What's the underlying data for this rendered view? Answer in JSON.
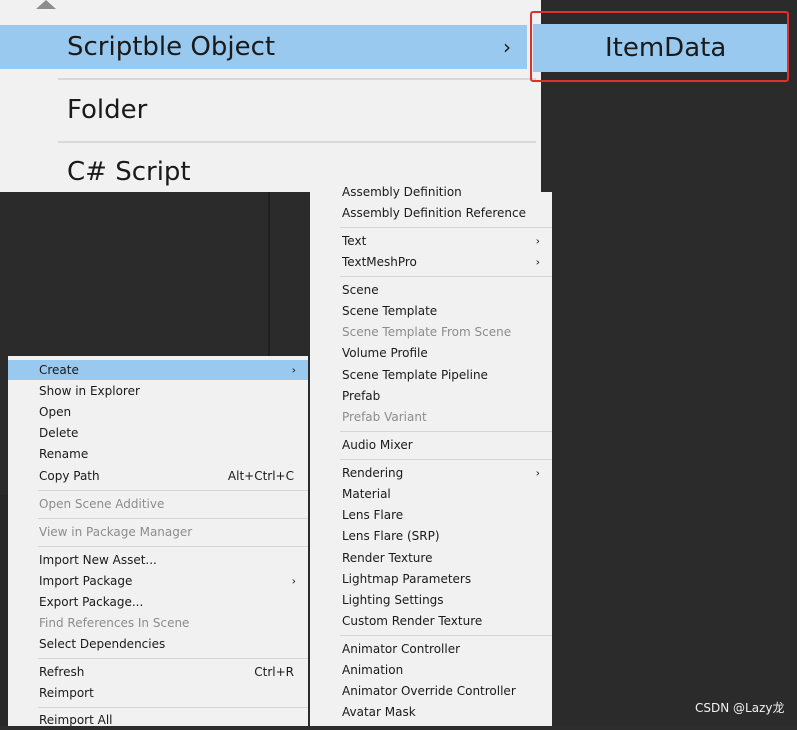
{
  "zoomed_menu": {
    "items": [
      {
        "label": "Scriptble Object",
        "highlighted": true,
        "submenu": true
      },
      {
        "label": "Folder"
      },
      {
        "label": "C# Script"
      }
    ],
    "submenu_item": "ItemData"
  },
  "context_menu": {
    "items": [
      {
        "label": "Create",
        "highlighted": true,
        "submenu": true
      },
      {
        "label": "Show in Explorer"
      },
      {
        "label": "Open"
      },
      {
        "label": "Delete"
      },
      {
        "label": "Rename"
      },
      {
        "label": "Copy Path",
        "shortcut": "Alt+Ctrl+C"
      },
      {
        "label": "Open Scene Additive",
        "disabled": true
      },
      {
        "label": "View in Package Manager",
        "disabled": true
      },
      {
        "label": "Import New Asset..."
      },
      {
        "label": "Import Package",
        "submenu": true
      },
      {
        "label": "Export Package..."
      },
      {
        "label": "Find References In Scene",
        "disabled": true
      },
      {
        "label": "Select Dependencies"
      },
      {
        "label": "Refresh",
        "shortcut": "Ctrl+R"
      },
      {
        "label": "Reimport"
      },
      {
        "label": "Reimport All"
      }
    ]
  },
  "create_submenu": {
    "items": [
      {
        "label": "Assembly Definition"
      },
      {
        "label": "Assembly Definition Reference"
      },
      {
        "label": "Text",
        "submenu": true
      },
      {
        "label": "TextMeshPro",
        "submenu": true
      },
      {
        "label": "Scene"
      },
      {
        "label": "Scene Template"
      },
      {
        "label": "Scene Template From Scene",
        "disabled": true
      },
      {
        "label": "Volume Profile"
      },
      {
        "label": "Scene Template Pipeline"
      },
      {
        "label": "Prefab"
      },
      {
        "label": "Prefab Variant",
        "disabled": true
      },
      {
        "label": "Audio Mixer"
      },
      {
        "label": "Rendering",
        "submenu": true
      },
      {
        "label": "Material"
      },
      {
        "label": "Lens Flare"
      },
      {
        "label": "Lens Flare (SRP)"
      },
      {
        "label": "Render Texture"
      },
      {
        "label": "Lightmap Parameters"
      },
      {
        "label": "Lighting Settings"
      },
      {
        "label": "Custom Render Texture"
      },
      {
        "label": "Animator Controller"
      },
      {
        "label": "Animation"
      },
      {
        "label": "Animator Override Controller"
      },
      {
        "label": "Avatar Mask"
      }
    ]
  },
  "icons": {
    "submenu": "›",
    "scroll_up": "triangle-up"
  },
  "colors": {
    "highlight": "#99c9ef",
    "callout": "#e0302b",
    "menu_bg": "#f1f1f1"
  },
  "watermark": "CSDN @Lazy龙"
}
